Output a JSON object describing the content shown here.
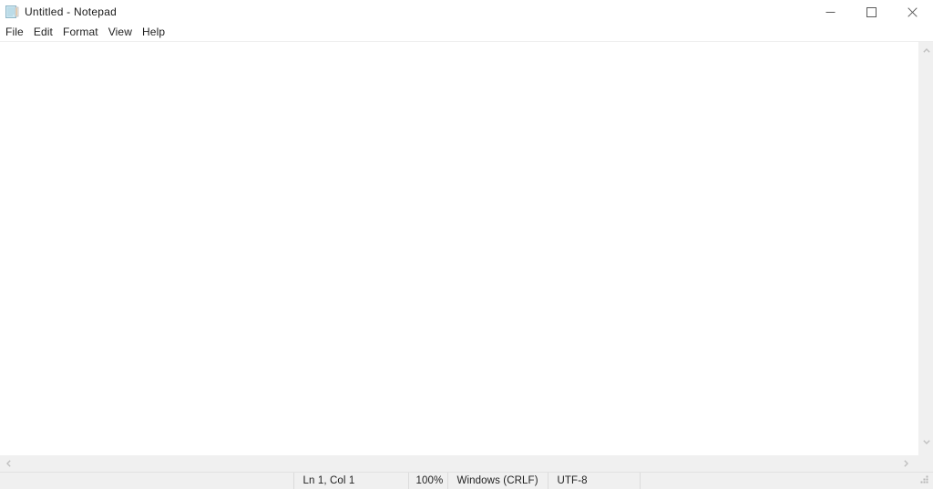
{
  "window": {
    "title": "Untitled - Notepad",
    "icon": "notepad-document-icon",
    "controls": {
      "minimize_label": "Minimize",
      "maximize_label": "Maximize",
      "close_label": "Close"
    }
  },
  "menubar": {
    "items": [
      {
        "label": "File"
      },
      {
        "label": "Edit"
      },
      {
        "label": "Format"
      },
      {
        "label": "View"
      },
      {
        "label": "Help"
      }
    ]
  },
  "editor": {
    "value": "",
    "placeholder": ""
  },
  "scrollbars": {
    "vertical": {
      "up_icon": "chevron-up-icon",
      "down_icon": "chevron-down-icon"
    },
    "horizontal": {
      "left_icon": "chevron-left-icon",
      "right_icon": "chevron-right-icon"
    }
  },
  "statusbar": {
    "cursor_position": "Ln 1, Col 1",
    "zoom": "100%",
    "line_ending": "Windows (CRLF)",
    "encoding": "UTF-8",
    "grip_icon": "resize-grip-icon"
  },
  "colors": {
    "window_bg": "#ffffff",
    "chrome_bg": "#f0f0f0",
    "divider": "#dcdcdc",
    "text": "#1f1f1f",
    "icon_blue": "#b9dcea"
  }
}
